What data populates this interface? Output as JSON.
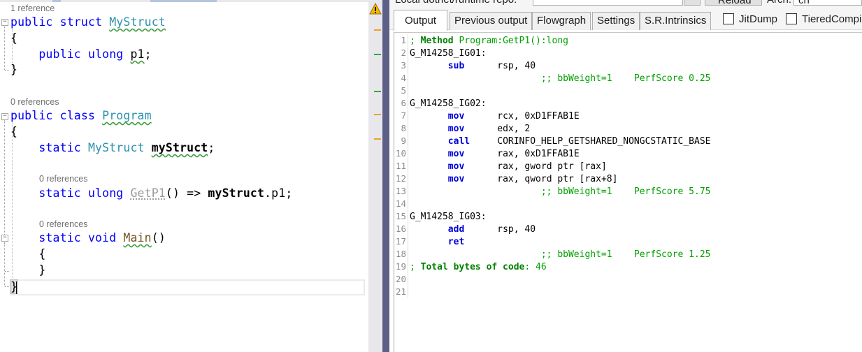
{
  "editor": {
    "lens_refs": [
      "1 reference",
      "0 references",
      "0 references",
      "0 references"
    ],
    "lines": {
      "struct_kw1": "public",
      "struct_kw2": "struct",
      "struct_name": "MyStruct",
      "open_brace": "{",
      "close_brace": "}",
      "field_kw1": "public",
      "field_kw2": "ulong",
      "field_name": "p1",
      "semi": ";",
      "class_kw1": "public",
      "class_kw2": "class",
      "class_name": "Program",
      "static_kw": "static",
      "field_type": "MyStruct",
      "field2_name": "myStruct",
      "ulong_kw": "ulong",
      "getp1_name": "GetP1",
      "parens": "()",
      "arrow": "=>",
      "dot_p1": ".p1",
      "void_kw": "void",
      "main_name": "Main",
      "final_brace": "}"
    }
  },
  "panel": {
    "top_strip_text": "Local dotnet/runtime repo:",
    "top_strip_reload": "Reload",
    "top_strip_arch_label": "Arch:",
    "top_strip_arch_value": "ch",
    "tabs": [
      "Output",
      "Previous output",
      "Flowgraph",
      "Settings",
      "S.R.Intrinsics"
    ],
    "checkboxes": [
      "JitDump",
      "TieredCompi"
    ]
  },
  "asm": {
    "l1_a": "; ",
    "l1_b": "Method",
    "l1_c": " Program:GetP1():long",
    "l2": "G_M14258_IG01:",
    "l3_ins": "sub",
    "l3_ops": "rsp, 40",
    "l4_cm": ";; bbWeight=1    PerfScore 0.25",
    "l6": "G_M14258_IG02:",
    "l7_ins": "mov",
    "l7_ops": "rcx, 0xD1FFAB1E",
    "l8_ins": "mov",
    "l8_ops": "edx, 2",
    "l9_ins": "call",
    "l9_ops": "CORINFO_HELP_GETSHARED_NONGCSTATIC_BASE",
    "l10_ins": "mov",
    "l10_ops": "rax, 0xD1FFAB1E",
    "l11_ins": "mov",
    "l11_ops": "rax, gword ptr [rax]",
    "l12_ins": "mov",
    "l12_ops": "rax, qword ptr [rax+8]",
    "l13_cm": ";; bbWeight=1    PerfScore 5.75",
    "l15": "G_M14258_IG03:",
    "l16_ins": "add",
    "l16_ops": "rsp, 40",
    "l17_ins": "ret",
    "l18_cm": ";; bbWeight=1    PerfScore 1.25",
    "l19_a": "; ",
    "l19_b": "Total bytes of code",
    "l19_c": ": 46",
    "line_numbers": [
      "1",
      "2",
      "3",
      "4",
      "5",
      "6",
      "7",
      "8",
      "9",
      "10",
      "11",
      "12",
      "13",
      "14",
      "15",
      "16",
      "17",
      "18",
      "19",
      "20",
      "21"
    ]
  }
}
